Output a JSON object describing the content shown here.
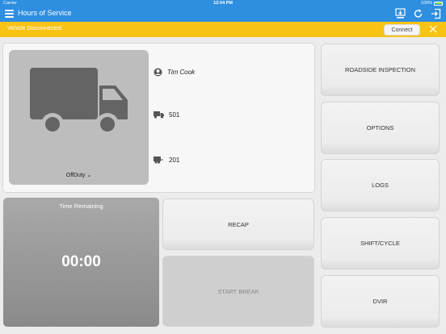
{
  "status_bar": {
    "carrier": "Carrier",
    "time": "12:04 PM",
    "battery": "100%"
  },
  "navbar": {
    "title": "Hours of Service",
    "icons": [
      "menu-icon",
      "download-icon",
      "refresh-icon",
      "logout-icon"
    ]
  },
  "banner": {
    "message": "Vehicle Disconnected",
    "connect_label": "Connect",
    "color": "#f7c314"
  },
  "driver": {
    "name": "Tim Cook",
    "truck_number": "501",
    "trailer_number": "201",
    "duty_status": "OffDuty"
  },
  "timer": {
    "label": "Time Remaining",
    "value": "00:00"
  },
  "actions": {
    "recap": "RECAP",
    "start_break": "START BREAK",
    "roadside_inspection": "ROADSIDE INSPECTION",
    "options": "OPTIONS",
    "logs": "LOGS",
    "shift_cycle": "SHIFT/CYCLE",
    "dvir": "DVIR"
  },
  "colors": {
    "accent": "#2e8ee0",
    "warning": "#f7c314"
  }
}
